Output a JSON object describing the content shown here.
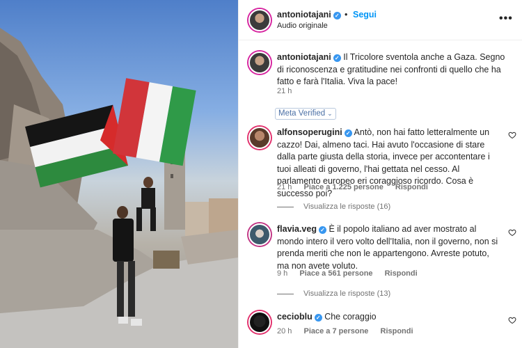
{
  "post": {
    "username": "antoniotajani",
    "follow_label": "Segui",
    "separator": "•",
    "audio": "Audio originale",
    "more_label": "•••"
  },
  "caption": {
    "username": "antoniotajani",
    "text": "Il Tricolore sventola anche a Gaza. Segno di riconoscenza e gratitudine nei confronti di quello che ha fatto e farà l'Italia. Viva la pace!",
    "time": "21 h"
  },
  "meta_verified": {
    "label": "Meta Verified",
    "chevron": "⌄"
  },
  "comments": [
    {
      "username": "alfonsoperugini",
      "text": "Antò, non hai fatto letteralmente un cazzo! Dai, almeno taci. Hai avuto l'occasione di stare dalla parte giusta della storia, invece per accontentare i tuoi alleati di governo, l'hai gettata nel cesso. Al parlamento europeo eri coraggioso ricordo. Cosa è successo poi?",
      "time": "21 h",
      "likes": "Piace a 1.225 persone",
      "reply": "Rispondi",
      "view_replies": "Visualizza le risposte (16)"
    },
    {
      "username": "flavia.veg",
      "text": "È il popolo italiano ad aver mostrato al mondo intero il vero volto dell'Italia, non il governo, non si prenda meriti che non le appartengono. Avreste potuto, ma non avete voluto.",
      "time": "9 h",
      "likes": "Piace a 561 persone",
      "reply": "Rispondi",
      "view_replies": "Visualizza le risposte (13)"
    },
    {
      "username": "cecioblu",
      "text": "Che coraggio",
      "time": "20 h",
      "likes": "Piace a 7 persone",
      "reply": "Rispondi"
    }
  ],
  "colors": {
    "accent": "#0095f6",
    "verified": "#3897f0",
    "secondary_text": "#737373"
  },
  "icons": {
    "verified": "verified-badge-icon",
    "heart": "heart-outline-icon",
    "more": "more-options-icon"
  }
}
